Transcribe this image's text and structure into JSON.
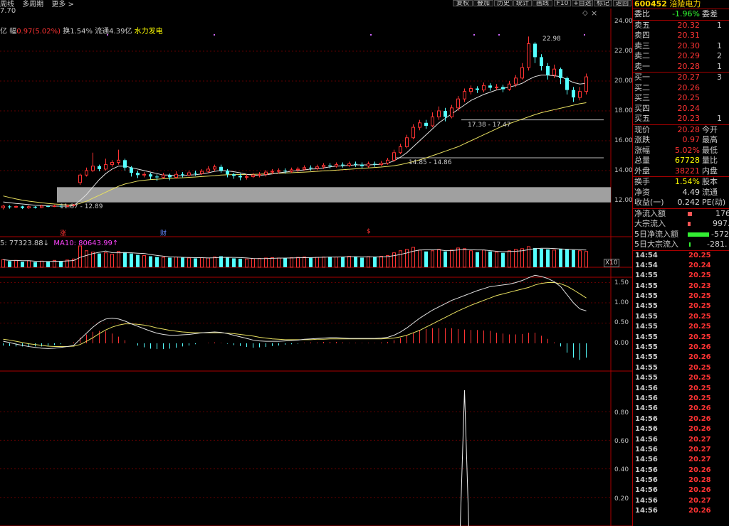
{
  "topbar": {
    "left_items": [
      "周线",
      "多周期",
      "更多 >"
    ],
    "buttons": [
      "复权",
      "叠加",
      "历史",
      "统计",
      "画线",
      "F10",
      "+自选",
      "标记",
      "返回"
    ],
    "window_icons": [
      "◇",
      "×"
    ]
  },
  "header": {
    "price": "7.70",
    "info": {
      "unit": "亿",
      "amp_label": "幅",
      "amp_value": "0.97(5.02%)",
      "turnover": "换1.54%",
      "float": "流通4.39亿",
      "concept": "水力发电"
    }
  },
  "volume_header": {
    "vol5": "5: 77323.88↓",
    "ma10": "MA10: 80643.99↑"
  },
  "signals": [
    {
      "text": "涨",
      "color": "#ff3333"
    },
    {
      "text": "财",
      "color": "#6688ff"
    },
    {
      "text": "$",
      "color": "#ff3333"
    }
  ],
  "annotations": {
    "high": "22.98",
    "zone1": "17.38 - 17.47",
    "zone2": "14.85 - 14.86",
    "zone3": "11.87 - 12.89",
    "x10": "X10"
  },
  "axes": {
    "price": [
      "24.00",
      "22.00",
      "20.00",
      "18.00",
      "16.00",
      "14.00",
      "12.00"
    ],
    "macd": [
      "1.50",
      "1.00",
      "0.50",
      "0.00"
    ],
    "bottom": [
      "0.80",
      "0.60",
      "0.40",
      "0.20"
    ]
  },
  "panel": {
    "code": "600452",
    "name": "涪陵电力",
    "weibi": {
      "label": "委比",
      "value": "-1.96%",
      "label2": "委差"
    },
    "asks": [
      {
        "label": "卖五",
        "price": "20.32",
        "vol": "1"
      },
      {
        "label": "卖四",
        "price": "20.31",
        "vol": ""
      },
      {
        "label": "卖三",
        "price": "20.30",
        "vol": "1"
      },
      {
        "label": "卖二",
        "price": "20.29",
        "vol": "2"
      },
      {
        "label": "卖一",
        "price": "20.28",
        "vol": "1"
      }
    ],
    "bids": [
      {
        "label": "买一",
        "price": "20.27",
        "vol": "3"
      },
      {
        "label": "买二",
        "price": "20.26",
        "vol": ""
      },
      {
        "label": "买三",
        "price": "20.25",
        "vol": ""
      },
      {
        "label": "买四",
        "price": "20.24",
        "vol": ""
      },
      {
        "label": "买五",
        "price": "20.23",
        "vol": "1"
      }
    ],
    "stats": [
      {
        "l": "现价",
        "v": "20.28",
        "l2": "今开",
        "color": "red"
      },
      {
        "l": "涨跌",
        "v": "0.97",
        "l2": "最高",
        "color": "red"
      },
      {
        "l": "涨幅",
        "v": "5.02%",
        "l2": "最低",
        "color": "red"
      },
      {
        "l": "总量",
        "v": "67728",
        "l2": "量比",
        "color": "yellow"
      },
      {
        "l": "外盘",
        "v": "38221",
        "l2": "内盘",
        "color": "red"
      }
    ],
    "stats2": [
      {
        "l": "换手",
        "v": "1.54%",
        "l2": "股本",
        "color": "yellow"
      },
      {
        "l": "净资",
        "v": "4.49",
        "l2": "流通",
        "color": "white"
      },
      {
        "l": "收益(一)",
        "v": "0.242",
        "l2": "PE(动)",
        "color": "white"
      }
    ],
    "flows": [
      {
        "l": "净流入额",
        "v": "176",
        "color": "red",
        "bar": "#ff5555",
        "barw": 6
      },
      {
        "l": "大宗流入",
        "v": "997.",
        "color": "red",
        "bar": "#ff5555",
        "barw": 4
      },
      {
        "l": "5日净流入额",
        "v": "-572",
        "color": "green",
        "bar": "#33ee33",
        "barw": 32
      },
      {
        "l": "5日大宗流入",
        "v": "-281.",
        "color": "green",
        "bar": "#33ee33",
        "barw": 2
      }
    ],
    "ticks": [
      {
        "t": "14:54",
        "p": "20.25"
      },
      {
        "t": "14:54",
        "p": "20.24"
      },
      {
        "t": "14:55",
        "p": "20.25"
      },
      {
        "t": "14:55",
        "p": "20.23"
      },
      {
        "t": "14:55",
        "p": "20.25"
      },
      {
        "t": "14:55",
        "p": "20.25"
      },
      {
        "t": "14:55",
        "p": "20.25"
      },
      {
        "t": "14:55",
        "p": "20.25"
      },
      {
        "t": "14:55",
        "p": "20.25"
      },
      {
        "t": "14:55",
        "p": "20.26"
      },
      {
        "t": "14:55",
        "p": "20.26"
      },
      {
        "t": "14:55",
        "p": "20.25"
      },
      {
        "t": "14:55",
        "p": "20.25"
      },
      {
        "t": "14:56",
        "p": "20.25"
      },
      {
        "t": "14:56",
        "p": "20.25"
      },
      {
        "t": "14:56",
        "p": "20.26"
      },
      {
        "t": "14:56",
        "p": "20.26"
      },
      {
        "t": "14:56",
        "p": "20.26"
      },
      {
        "t": "14:56",
        "p": "20.27"
      },
      {
        "t": "14:56",
        "p": "20.27"
      },
      {
        "t": "14:56",
        "p": "20.27"
      },
      {
        "t": "14:56",
        "p": "20.26"
      },
      {
        "t": "14:56",
        "p": "20.28"
      },
      {
        "t": "14:56",
        "p": "20.26"
      },
      {
        "t": "14:56",
        "p": "20.27"
      },
      {
        "t": "14:56",
        "p": "20.26"
      }
    ]
  },
  "colors": {
    "up": "#ff3333",
    "down": "#54ffff",
    "ma_white": "#e0e0e0",
    "ma_yellow": "#e8e060",
    "grid": "#600000"
  },
  "chart_data": {
    "type": "candlestick",
    "candles": [
      [
        11.52,
        11.62,
        11.4,
        11.7
      ],
      [
        11.6,
        11.55,
        11.45,
        11.68
      ],
      [
        11.55,
        11.6,
        11.48,
        11.66
      ],
      [
        11.6,
        11.5,
        11.42,
        11.64
      ],
      [
        11.5,
        11.58,
        11.44,
        11.66
      ],
      [
        11.58,
        11.52,
        11.46,
        11.62
      ],
      [
        11.52,
        11.62,
        11.48,
        11.7
      ],
      [
        11.62,
        11.6,
        11.54,
        11.66
      ],
      [
        11.6,
        11.64,
        11.56,
        11.7
      ],
      [
        11.64,
        11.6,
        11.55,
        11.68
      ],
      [
        11.6,
        11.66,
        11.56,
        11.72
      ],
      [
        11.66,
        11.7,
        11.6,
        11.76
      ],
      [
        13.2,
        13.7,
        13.05,
        13.8
      ],
      [
        13.7,
        14.0,
        13.6,
        14.2
      ],
      [
        14.0,
        14.3,
        13.9,
        15.2
      ],
      [
        14.3,
        14.1,
        13.95,
        14.4
      ],
      [
        14.1,
        14.4,
        14.0,
        14.8
      ],
      [
        14.4,
        14.55,
        14.25,
        14.7
      ],
      [
        14.55,
        14.7,
        14.4,
        15.4
      ],
      [
        14.7,
        14.2,
        14.0,
        14.8
      ],
      [
        14.2,
        13.85,
        13.6,
        14.3
      ],
      [
        13.85,
        13.7,
        13.5,
        14.0
      ],
      [
        13.7,
        13.75,
        13.55,
        13.9
      ],
      [
        13.75,
        13.6,
        13.4,
        13.85
      ],
      [
        13.6,
        13.55,
        13.3,
        13.75
      ],
      [
        13.55,
        13.7,
        13.45,
        13.85
      ],
      [
        13.7,
        13.55,
        13.35,
        13.8
      ],
      [
        13.55,
        13.75,
        13.45,
        13.95
      ],
      [
        13.75,
        13.7,
        13.55,
        13.9
      ],
      [
        13.7,
        13.85,
        13.6,
        14.0
      ],
      [
        13.85,
        13.8,
        13.65,
        14.0
      ],
      [
        13.8,
        13.95,
        13.7,
        14.1
      ],
      [
        13.95,
        14.1,
        13.85,
        14.3
      ],
      [
        14.1,
        14.25,
        13.95,
        14.4
      ],
      [
        14.25,
        14.0,
        13.85,
        14.4
      ],
      [
        14.0,
        13.75,
        13.55,
        14.1
      ],
      [
        13.75,
        13.65,
        13.45,
        13.85
      ],
      [
        13.65,
        13.55,
        13.35,
        13.8
      ],
      [
        13.55,
        13.6,
        13.4,
        13.75
      ],
      [
        13.6,
        13.7,
        13.5,
        13.85
      ],
      [
        13.7,
        13.75,
        13.55,
        13.9
      ],
      [
        13.75,
        13.9,
        13.6,
        14.05
      ],
      [
        13.9,
        13.95,
        13.75,
        14.1
      ],
      [
        13.95,
        14.0,
        13.8,
        14.15
      ],
      [
        14.0,
        13.95,
        13.8,
        14.15
      ],
      [
        13.95,
        14.05,
        13.85,
        14.2
      ],
      [
        14.05,
        14.1,
        13.9,
        14.25
      ],
      [
        14.1,
        14.2,
        14.0,
        14.35
      ],
      [
        14.2,
        14.15,
        14.0,
        14.35
      ],
      [
        14.15,
        14.25,
        14.05,
        14.4
      ],
      [
        14.25,
        14.35,
        14.1,
        14.5
      ],
      [
        14.35,
        14.3,
        14.15,
        14.5
      ],
      [
        14.3,
        14.4,
        14.2,
        14.55
      ],
      [
        14.4,
        14.35,
        14.2,
        14.55
      ],
      [
        14.35,
        14.45,
        14.25,
        14.6
      ],
      [
        14.45,
        14.4,
        14.25,
        14.6
      ],
      [
        14.4,
        14.3,
        14.15,
        14.55
      ],
      [
        14.3,
        14.45,
        14.2,
        14.6
      ],
      [
        14.45,
        14.4,
        14.25,
        14.6
      ],
      [
        14.4,
        14.5,
        14.3,
        14.65
      ],
      [
        14.5,
        14.7,
        14.4,
        14.85
      ],
      [
        14.7,
        15.2,
        14.6,
        15.4
      ],
      [
        15.2,
        15.6,
        15.1,
        15.8
      ],
      [
        15.6,
        16.2,
        15.5,
        16.4
      ],
      [
        16.2,
        16.9,
        16.1,
        17.1
      ],
      [
        16.9,
        17.2,
        16.7,
        17.4
      ],
      [
        17.2,
        17.0,
        16.8,
        17.4
      ],
      [
        17.0,
        17.6,
        16.9,
        17.9
      ],
      [
        17.6,
        18.0,
        17.4,
        18.3
      ],
      [
        18.0,
        17.6,
        17.3,
        18.2
      ],
      [
        17.6,
        18.2,
        17.5,
        18.4
      ],
      [
        18.2,
        18.8,
        18.0,
        19.0
      ],
      [
        18.8,
        19.3,
        18.6,
        19.5
      ],
      [
        19.3,
        19.5,
        19.1,
        19.7
      ],
      [
        19.5,
        19.4,
        19.2,
        19.65
      ],
      [
        19.4,
        19.7,
        19.25,
        19.9
      ],
      [
        19.7,
        19.55,
        19.35,
        19.85
      ],
      [
        19.55,
        19.6,
        19.4,
        19.8
      ],
      [
        19.6,
        19.45,
        19.25,
        19.75
      ],
      [
        19.45,
        19.8,
        19.35,
        20.0
      ],
      [
        19.8,
        20.2,
        19.6,
        20.4
      ],
      [
        20.2,
        20.9,
        20.1,
        21.2
      ],
      [
        20.9,
        22.5,
        20.7,
        22.98
      ],
      [
        22.5,
        21.6,
        21.2,
        22.6
      ],
      [
        21.6,
        21.0,
        20.7,
        21.8
      ],
      [
        21.0,
        20.4,
        20.1,
        21.2
      ],
      [
        20.4,
        20.8,
        20.2,
        21.1
      ],
      [
        20.8,
        20.2,
        19.8,
        20.9
      ],
      [
        20.2,
        19.4,
        19.1,
        20.3
      ],
      [
        19.4,
        18.9,
        18.6,
        19.6
      ],
      [
        18.9,
        19.3,
        18.7,
        19.6
      ],
      [
        19.3,
        20.28,
        19.1,
        20.5
      ]
    ],
    "ma_fast": [
      11.9,
      11.85,
      11.8,
      11.76,
      11.72,
      11.68,
      11.66,
      11.64,
      11.62,
      11.62,
      11.62,
      11.64,
      12.0,
      12.4,
      12.9,
      13.4,
      13.8,
      14.1,
      14.3,
      14.3,
      14.2,
      14.1,
      14.0,
      13.9,
      13.8,
      13.7,
      13.7,
      13.65,
      13.65,
      13.7,
      13.72,
      13.78,
      13.85,
      13.95,
      14.0,
      13.98,
      13.92,
      13.85,
      13.75,
      13.7,
      13.68,
      13.72,
      13.78,
      13.85,
      13.9,
      13.95,
      14.0,
      14.05,
      14.1,
      14.12,
      14.18,
      14.25,
      14.3,
      14.32,
      14.35,
      14.38,
      14.38,
      14.38,
      14.4,
      14.42,
      14.5,
      14.65,
      14.9,
      15.2,
      15.6,
      16.0,
      16.4,
      16.8,
      17.2,
      17.5,
      17.8,
      18.1,
      18.4,
      18.7,
      18.9,
      19.1,
      19.25,
      19.4,
      19.5,
      19.6,
      19.7,
      19.85,
      20.1,
      20.3,
      20.4,
      20.4,
      20.35,
      20.3,
      20.1,
      19.9,
      19.8,
      19.85
    ],
    "ma_slow": [
      12.3,
      12.2,
      12.1,
      12.02,
      11.95,
      11.9,
      11.85,
      11.8,
      11.76,
      11.73,
      11.7,
      11.7,
      11.8,
      11.95,
      12.15,
      12.35,
      12.55,
      12.75,
      12.95,
      13.1,
      13.2,
      13.3,
      13.35,
      13.4,
      13.42,
      13.45,
      13.47,
      13.5,
      13.52,
      13.55,
      13.57,
      13.6,
      13.63,
      13.66,
      13.7,
      13.72,
      13.73,
      13.74,
      13.74,
      13.75,
      13.76,
      13.78,
      13.8,
      13.82,
      13.84,
      13.86,
      13.88,
      13.9,
      13.92,
      13.95,
      13.98,
      14.0,
      14.03,
      14.06,
      14.09,
      14.12,
      14.15,
      14.18,
      14.21,
      14.24,
      14.28,
      14.33,
      14.4,
      14.5,
      14.6,
      14.72,
      14.85,
      15.0,
      15.15,
      15.3,
      15.45,
      15.6,
      15.8,
      16.0,
      16.2,
      16.4,
      16.6,
      16.8,
      17.0,
      17.15,
      17.3,
      17.45,
      17.6,
      17.75,
      17.88,
      17.98,
      18.08,
      18.18,
      18.28,
      18.38,
      18.48,
      18.55
    ],
    "volume": [
      22,
      18,
      20,
      16,
      19,
      15,
      18,
      16,
      20,
      17,
      21,
      24,
      62,
      48,
      44,
      40,
      42,
      38,
      46,
      44,
      40,
      36,
      34,
      32,
      30,
      29,
      28,
      30,
      28,
      27,
      26,
      28,
      27,
      30,
      32,
      28,
      26,
      25,
      24,
      25,
      26,
      27,
      28,
      27,
      26,
      28,
      29,
      30,
      28,
      29,
      30,
      31,
      30,
      31,
      32,
      30,
      28,
      31,
      30,
      32,
      34,
      42,
      48,
      52,
      58,
      50,
      46,
      48,
      52,
      46,
      50,
      56,
      54,
      48,
      44,
      50,
      46,
      44,
      42,
      48,
      52,
      54,
      60,
      56,
      54,
      52,
      50,
      54,
      52,
      50,
      48,
      46
    ],
    "macd_dif": [
      0.05,
      0.02,
      -0.02,
      -0.05,
      -0.08,
      -0.1,
      -0.12,
      -0.13,
      -0.12,
      -0.1,
      -0.08,
      -0.05,
      0.1,
      0.25,
      0.4,
      0.52,
      0.6,
      0.62,
      0.6,
      0.55,
      0.48,
      0.42,
      0.36,
      0.3,
      0.25,
      0.22,
      0.2,
      0.2,
      0.21,
      0.22,
      0.24,
      0.26,
      0.27,
      0.28,
      0.27,
      0.24,
      0.2,
      0.16,
      0.12,
      0.08,
      0.06,
      0.05,
      0.05,
      0.05,
      0.06,
      0.07,
      0.08,
      0.1,
      0.11,
      0.12,
      0.13,
      0.14,
      0.14,
      0.13,
      0.12,
      0.12,
      0.12,
      0.12,
      0.12,
      0.13,
      0.15,
      0.2,
      0.28,
      0.38,
      0.5,
      0.62,
      0.72,
      0.82,
      0.9,
      0.98,
      1.06,
      1.12,
      1.18,
      1.24,
      1.3,
      1.35,
      1.4,
      1.42,
      1.44,
      1.46,
      1.5,
      1.55,
      1.62,
      1.68,
      1.65,
      1.6,
      1.52,
      1.4,
      1.2,
      1.0,
      0.85,
      0.8
    ],
    "macd_dea": [
      0.1,
      0.08,
      0.05,
      0.02,
      -0.01,
      -0.03,
      -0.05,
      -0.07,
      -0.08,
      -0.08,
      -0.08,
      -0.07,
      -0.03,
      0.05,
      0.14,
      0.24,
      0.33,
      0.4,
      0.45,
      0.48,
      0.48,
      0.47,
      0.45,
      0.42,
      0.38,
      0.35,
      0.32,
      0.3,
      0.28,
      0.27,
      0.26,
      0.26,
      0.26,
      0.26,
      0.26,
      0.25,
      0.24,
      0.22,
      0.2,
      0.18,
      0.15,
      0.13,
      0.11,
      0.1,
      0.09,
      0.09,
      0.09,
      0.09,
      0.09,
      0.1,
      0.1,
      0.11,
      0.11,
      0.11,
      0.11,
      0.11,
      0.11,
      0.11,
      0.11,
      0.11,
      0.12,
      0.13,
      0.16,
      0.2,
      0.26,
      0.32,
      0.4,
      0.48,
      0.56,
      0.64,
      0.72,
      0.8,
      0.87,
      0.94,
      1.0,
      1.06,
      1.12,
      1.18,
      1.22,
      1.26,
      1.3,
      1.34,
      1.38,
      1.44,
      1.48,
      1.5,
      1.5,
      1.47,
      1.41,
      1.32,
      1.22,
      1.12
    ],
    "spike": {
      "index": 72,
      "value": 0.95
    }
  }
}
